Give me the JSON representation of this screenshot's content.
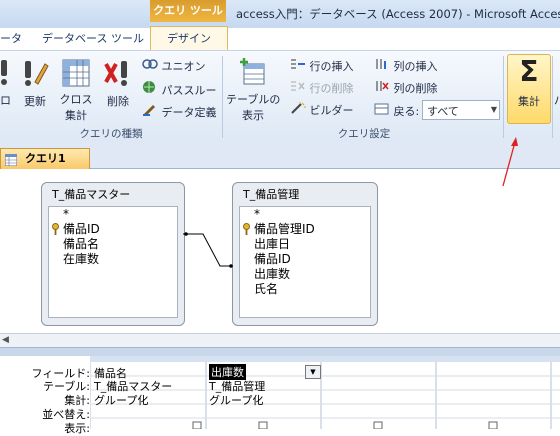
{
  "window": {
    "context_group": "クエリ ツール",
    "title": "access入門：データベース (Access 2007) - Microsoft Acces"
  },
  "tabs": {
    "left_partial": "ータ",
    "database_tools": "データベース ツール",
    "design": "デザイン"
  },
  "ribbon": {
    "query_type": {
      "label": "クエリの種類",
      "partial_button": "ロ",
      "update": "更新",
      "crosstab_line1": "クロス",
      "crosstab_line2": "集計",
      "delete": "削除",
      "union": "ユニオン",
      "passthrough": "パススルー",
      "data_definition": "データ定義"
    },
    "query_setup": {
      "label": "クエリ設定",
      "show_table_line1": "テーブルの",
      "show_table_line2": "表示",
      "insert_rows": "行の挿入",
      "delete_rows": "行の削除",
      "builder": "ビルダー",
      "insert_columns": "列の挿入",
      "delete_columns": "列の削除",
      "return_label": "戻る:",
      "return_value": "すべて"
    },
    "totals": {
      "label": "集計",
      "symbol": "Σ"
    },
    "partial_next": "パ"
  },
  "doc_tab": {
    "label": "クエリ1"
  },
  "tables": [
    {
      "name": "T_備品マスター",
      "star": "*",
      "fields": [
        "備品ID",
        "備品名",
        "在庫数"
      ]
    },
    {
      "name": "T_備品管理",
      "star": "*",
      "fields": [
        "備品管理ID",
        "出庫日",
        "備品ID",
        "出庫数",
        "氏名"
      ]
    }
  ],
  "grid": {
    "row_labels": [
      "フィールド:",
      "テーブル:",
      "集計:",
      "並べ替え:",
      "表示:"
    ],
    "columns": [
      {
        "field": "備品名",
        "table": "T_備品マスター",
        "total": "グループ化"
      },
      {
        "field": "出庫数",
        "table": "T_備品管理",
        "total": "グループ化"
      }
    ]
  },
  "colors": {
    "accent_orange": "#f0b640",
    "annotation_arrow": "#e02020",
    "ribbon_blue": "#dde8f5"
  }
}
